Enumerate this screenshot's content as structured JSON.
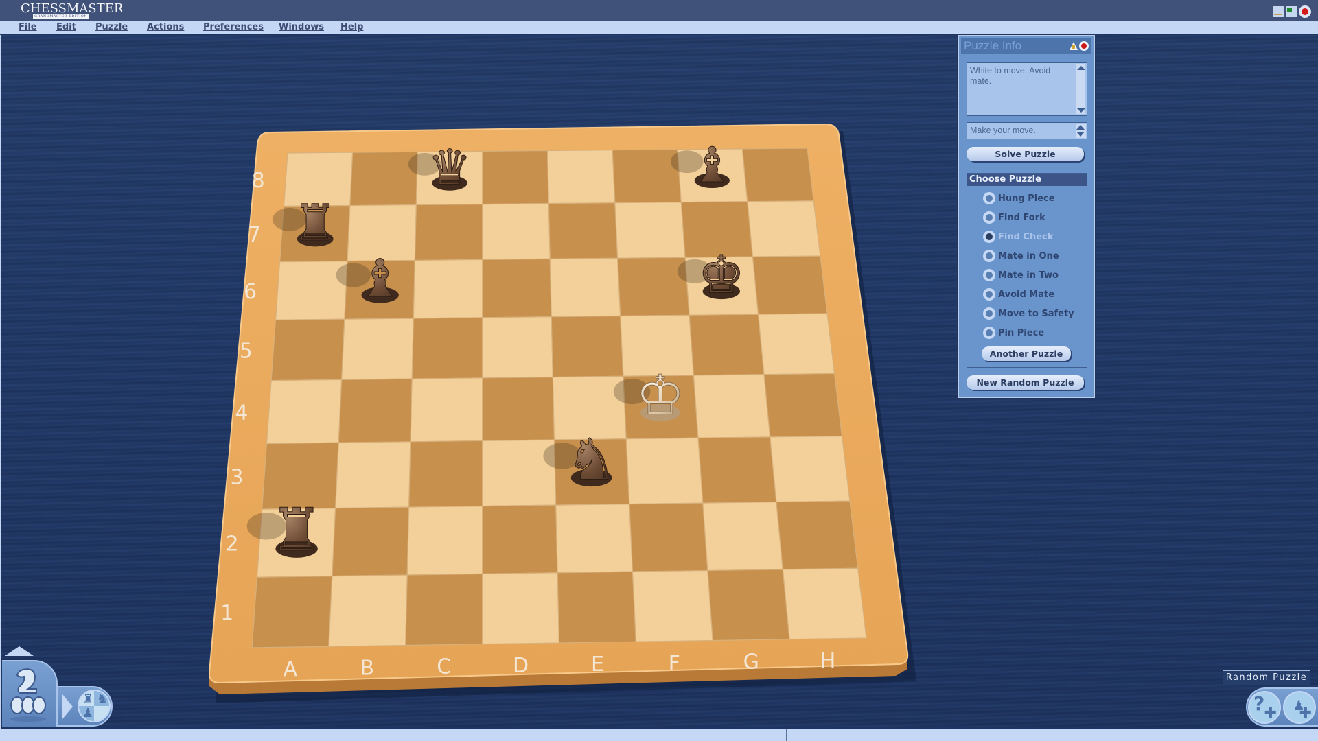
{
  "app": {
    "title_logo": "CHESSMASTER",
    "title_logo_sub": "GRANDMASTER EDITION"
  },
  "window_controls": {
    "minimize": "minimize-icon",
    "maximize": "maximize-icon",
    "close": "close-icon"
  },
  "menu": {
    "items": [
      {
        "label": "File",
        "accel": "F"
      },
      {
        "label": "Edit",
        "accel": "E"
      },
      {
        "label": "Puzzle",
        "accel": "P"
      },
      {
        "label": "Actions",
        "accel": "A"
      },
      {
        "label": "Preferences",
        "accel": "P"
      },
      {
        "label": "Windows",
        "accel": "W"
      },
      {
        "label": "Help",
        "accel": "H"
      }
    ]
  },
  "board": {
    "ranks": [
      "8",
      "7",
      "6",
      "5",
      "4",
      "3",
      "2",
      "1"
    ],
    "files": [
      "A",
      "B",
      "C",
      "D",
      "E",
      "F",
      "G",
      "H"
    ],
    "colors": {
      "light_square": "#f3cf9a",
      "dark_square": "#c7904d",
      "frame": "#e8a95c",
      "frame_edge": "#b97a37",
      "white_piece": "#e9d4b6",
      "black_piece": "#6b4a34"
    },
    "pieces": [
      {
        "color": "black",
        "type": "rook",
        "square": "a7",
        "glyph": "♜"
      },
      {
        "color": "black",
        "type": "queen",
        "square": "c8",
        "glyph": "♛"
      },
      {
        "color": "black",
        "type": "bishop",
        "square": "b6",
        "glyph": "♝"
      },
      {
        "color": "black",
        "type": "bishop",
        "square": "g8",
        "glyph": "♝"
      },
      {
        "color": "black",
        "type": "king",
        "square": "g6",
        "glyph": "♚"
      },
      {
        "color": "white",
        "type": "king",
        "square": "f4",
        "glyph": "♔"
      },
      {
        "color": "black",
        "type": "knight",
        "square": "e3",
        "glyph": "♞"
      },
      {
        "color": "black",
        "type": "rook",
        "square": "a2",
        "glyph": "♜"
      }
    ]
  },
  "puzzle_panel": {
    "title": "Puzzle Info",
    "info_text": "White to move. Avoid mate.",
    "move_prompt": "Make your move.",
    "solve_button": "Solve Puzzle",
    "choose_header": "Choose Puzzle",
    "options": [
      {
        "label": "Hung Piece",
        "selected": false
      },
      {
        "label": "Find Fork",
        "selected": false
      },
      {
        "label": "Find Check",
        "selected": true
      },
      {
        "label": "Mate in One",
        "selected": false
      },
      {
        "label": "Mate in Two",
        "selected": false
      },
      {
        "label": "Avoid Mate",
        "selected": false
      },
      {
        "label": "Move to Safety",
        "selected": false
      },
      {
        "label": "Pin Piece",
        "selected": false
      }
    ],
    "another_button": "Another Puzzle",
    "random_button": "New Random Puzzle"
  },
  "bottom_right": {
    "label": "Random Puzzle",
    "icons": [
      "puzzle-help-icon",
      "puzzle-pieces-icon"
    ]
  },
  "bottom_left": {
    "icons": [
      "mentor-knight-icon",
      "expand-arrow-icon",
      "board-mode-icon"
    ]
  }
}
